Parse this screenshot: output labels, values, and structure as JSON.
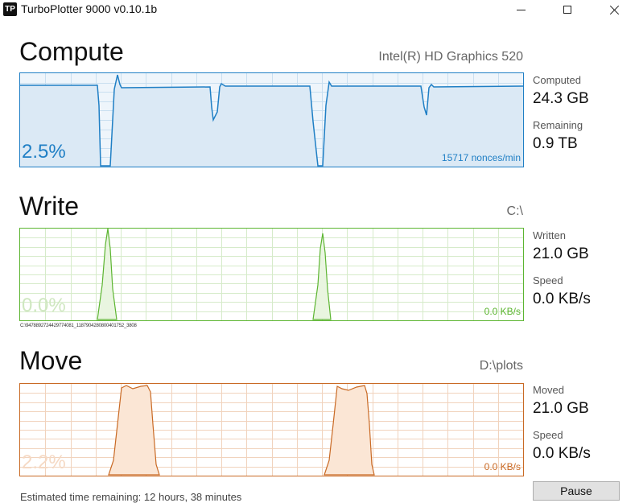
{
  "window": {
    "icon_text": "TP",
    "title": "TurboPlotter 9000 v0.10.1b"
  },
  "compute": {
    "title": "Compute",
    "device": "Intel(R) HD Graphics 520",
    "percent": "2.5%",
    "rate": "15717 nonces/min",
    "stats": [
      {
        "label": "Computed",
        "value": "24.3 GB"
      },
      {
        "label": "Remaining",
        "value": "0.9 TB"
      }
    ],
    "color": "#1f7fc5",
    "fill": "#eef5fb"
  },
  "write": {
    "title": "Write",
    "drive": "C:\\",
    "percent": "0.0%",
    "rate": "0.0 KB/s",
    "file_path": "C:\\9478892724429774081_1187904280800401752_3808",
    "stats": [
      {
        "label": "Written",
        "value": "21.0 GB"
      },
      {
        "label": "Speed",
        "value": "0.0 KB/s"
      }
    ],
    "color": "#5cb531",
    "fill": "#f0f8ea"
  },
  "move": {
    "title": "Move",
    "drive": "D:\\plots",
    "percent": "2.2%",
    "rate": "0.0 KB/s",
    "stats": [
      {
        "label": "Moved",
        "value": "21.0 GB"
      },
      {
        "label": "Speed",
        "value": "0.0 KB/s"
      }
    ],
    "color": "#c96a25",
    "fill": "#fceee2"
  },
  "footer": {
    "status": "Estimated time remaining: 12 hours, 38 minutes",
    "pause_label": "Pause"
  }
}
